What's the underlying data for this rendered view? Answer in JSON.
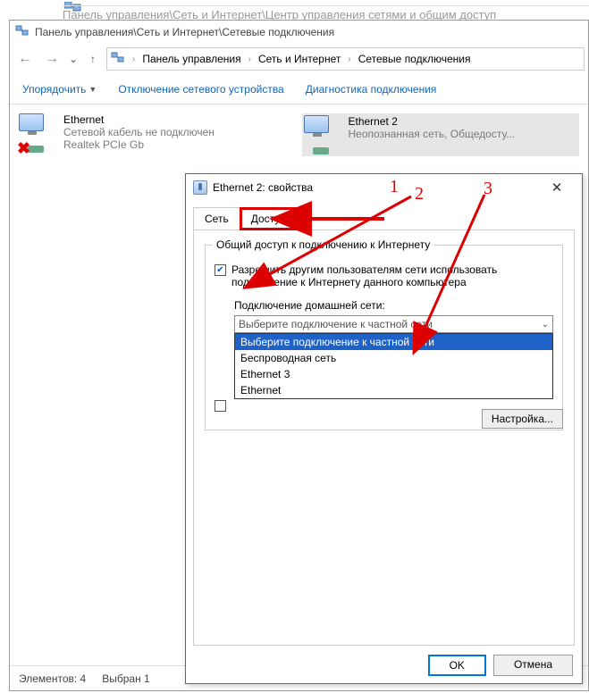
{
  "parent_window_title": "Панель управления\\Сеть и Интернет\\Центр управления сетями и общим доступ",
  "window": {
    "title": "Панель управления\\Сеть и Интернет\\Сетевые подключения",
    "breadcrumb": {
      "p1": "Панель управления",
      "p2": "Сеть и Интернет",
      "p3": "Сетевые подключения"
    }
  },
  "commands": {
    "organize": "Упорядочить",
    "disable": "Отключение сетевого устройства",
    "diagnose": "Диагностика подключения"
  },
  "connections": {
    "a": {
      "name": "Ethernet",
      "status": "Сетевой кабель не подключен",
      "device": "Realtek PCIe Gb"
    },
    "b": {
      "name": "Ethernet 2",
      "status": "Неопознанная сеть, Общедосту..."
    }
  },
  "statusbar": {
    "count": "Элементов: 4",
    "selected": "Выбран 1"
  },
  "dialog": {
    "title": "Ethernet 2: свойства",
    "tabs": {
      "network": "Сеть",
      "sharing": "Доступ"
    },
    "group_title": "Общий доступ к подключению к Интернету",
    "checkbox_allow": "Разрешить другим пользователям сети использовать подключение к Интернету данного компьютера",
    "home_label": "Подключение домашней сети:",
    "combo_value": "Выберите подключение к частной сети",
    "options": {
      "o1": "Выберите подключение к частной сети",
      "o2": "Беспроводная сеть",
      "o3": "Ethernet 3",
      "o4": "Ethernet"
    },
    "settings_btn": "Настройка...",
    "ok": "OK",
    "cancel": "Отмена"
  },
  "annotations": {
    "n1": "1",
    "n2": "2",
    "n3": "3"
  }
}
